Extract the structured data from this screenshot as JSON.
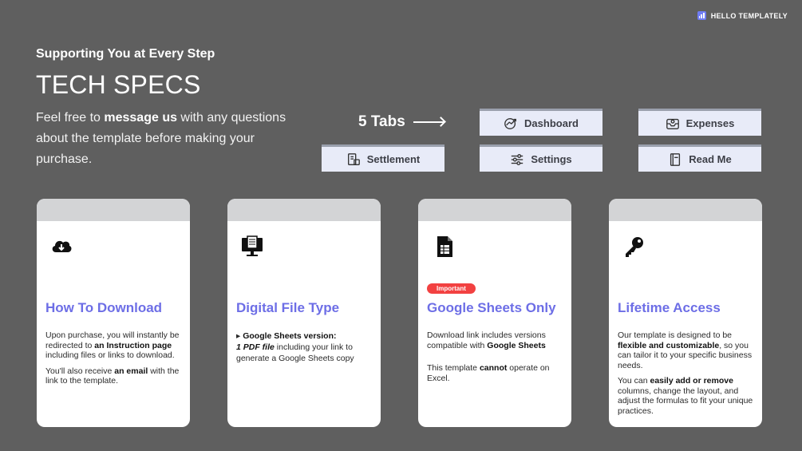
{
  "brand": {
    "name": "HELLO TEMPLATELY"
  },
  "header": {
    "subtitle": "Supporting You at Every Step",
    "title": "TECH SPECS",
    "intro_before": "Feel free to ",
    "intro_bold": "message us",
    "intro_after": " with any questions about the template before making your purchase."
  },
  "tabs": {
    "label": "5 Tabs",
    "items": [
      {
        "label": "Dashboard",
        "icon": "dashboard-chart-icon"
      },
      {
        "label": "Expenses",
        "icon": "expenses-tray-icon"
      },
      {
        "label": "Settlement",
        "icon": "settlement-doc-icon"
      },
      {
        "label": "Settings",
        "icon": "settings-sliders-icon"
      },
      {
        "label": "Read Me",
        "icon": "read-me-book-icon"
      }
    ]
  },
  "cards": [
    {
      "title": "How To Download",
      "icon": "cloud-download-icon",
      "p1_a": "Upon purchase, you will instantly be redirected to ",
      "p1_b": "an Instruction page",
      "p1_c": " including files or links to download.",
      "p2_a": "You'll also receive ",
      "p2_b": "an email",
      "p2_c": " with the link to the template."
    },
    {
      "title": "Digital File Type",
      "icon": "monitor-document-icon",
      "bullet": "▸ ",
      "p1_b": "Google Sheets version:",
      "p2_b": "1 PDF file",
      "p2_c": " including your link to generate a Google Sheets copy"
    },
    {
      "title": "Google Sheets Only",
      "icon": "spreadsheet-file-icon",
      "badge": "Important",
      "p1_a": "Download link includes versions compatible with ",
      "p1_b": "Google Sheets",
      "p2_a": "This template ",
      "p2_b": "cannot",
      "p2_c": " operate on Excel."
    },
    {
      "title": "Lifetime Access",
      "icon": "key-icon",
      "p1_a": "Our template is designed to be ",
      "p1_b": "flexible and customizable",
      "p1_c": ", so you can tailor it to your specific business needs.",
      "p2_a": "You can ",
      "p2_b": "easily add or remove",
      "p2_c": " columns, change the layout, and adjust the formulas to fit your unique practices."
    }
  ],
  "colors": {
    "background": "#5f5f5f",
    "card_title": "#6d6ee6",
    "tab_bg": "#e8ebf8",
    "badge": "#f24141",
    "brand_logo": "#6f7cf5"
  }
}
